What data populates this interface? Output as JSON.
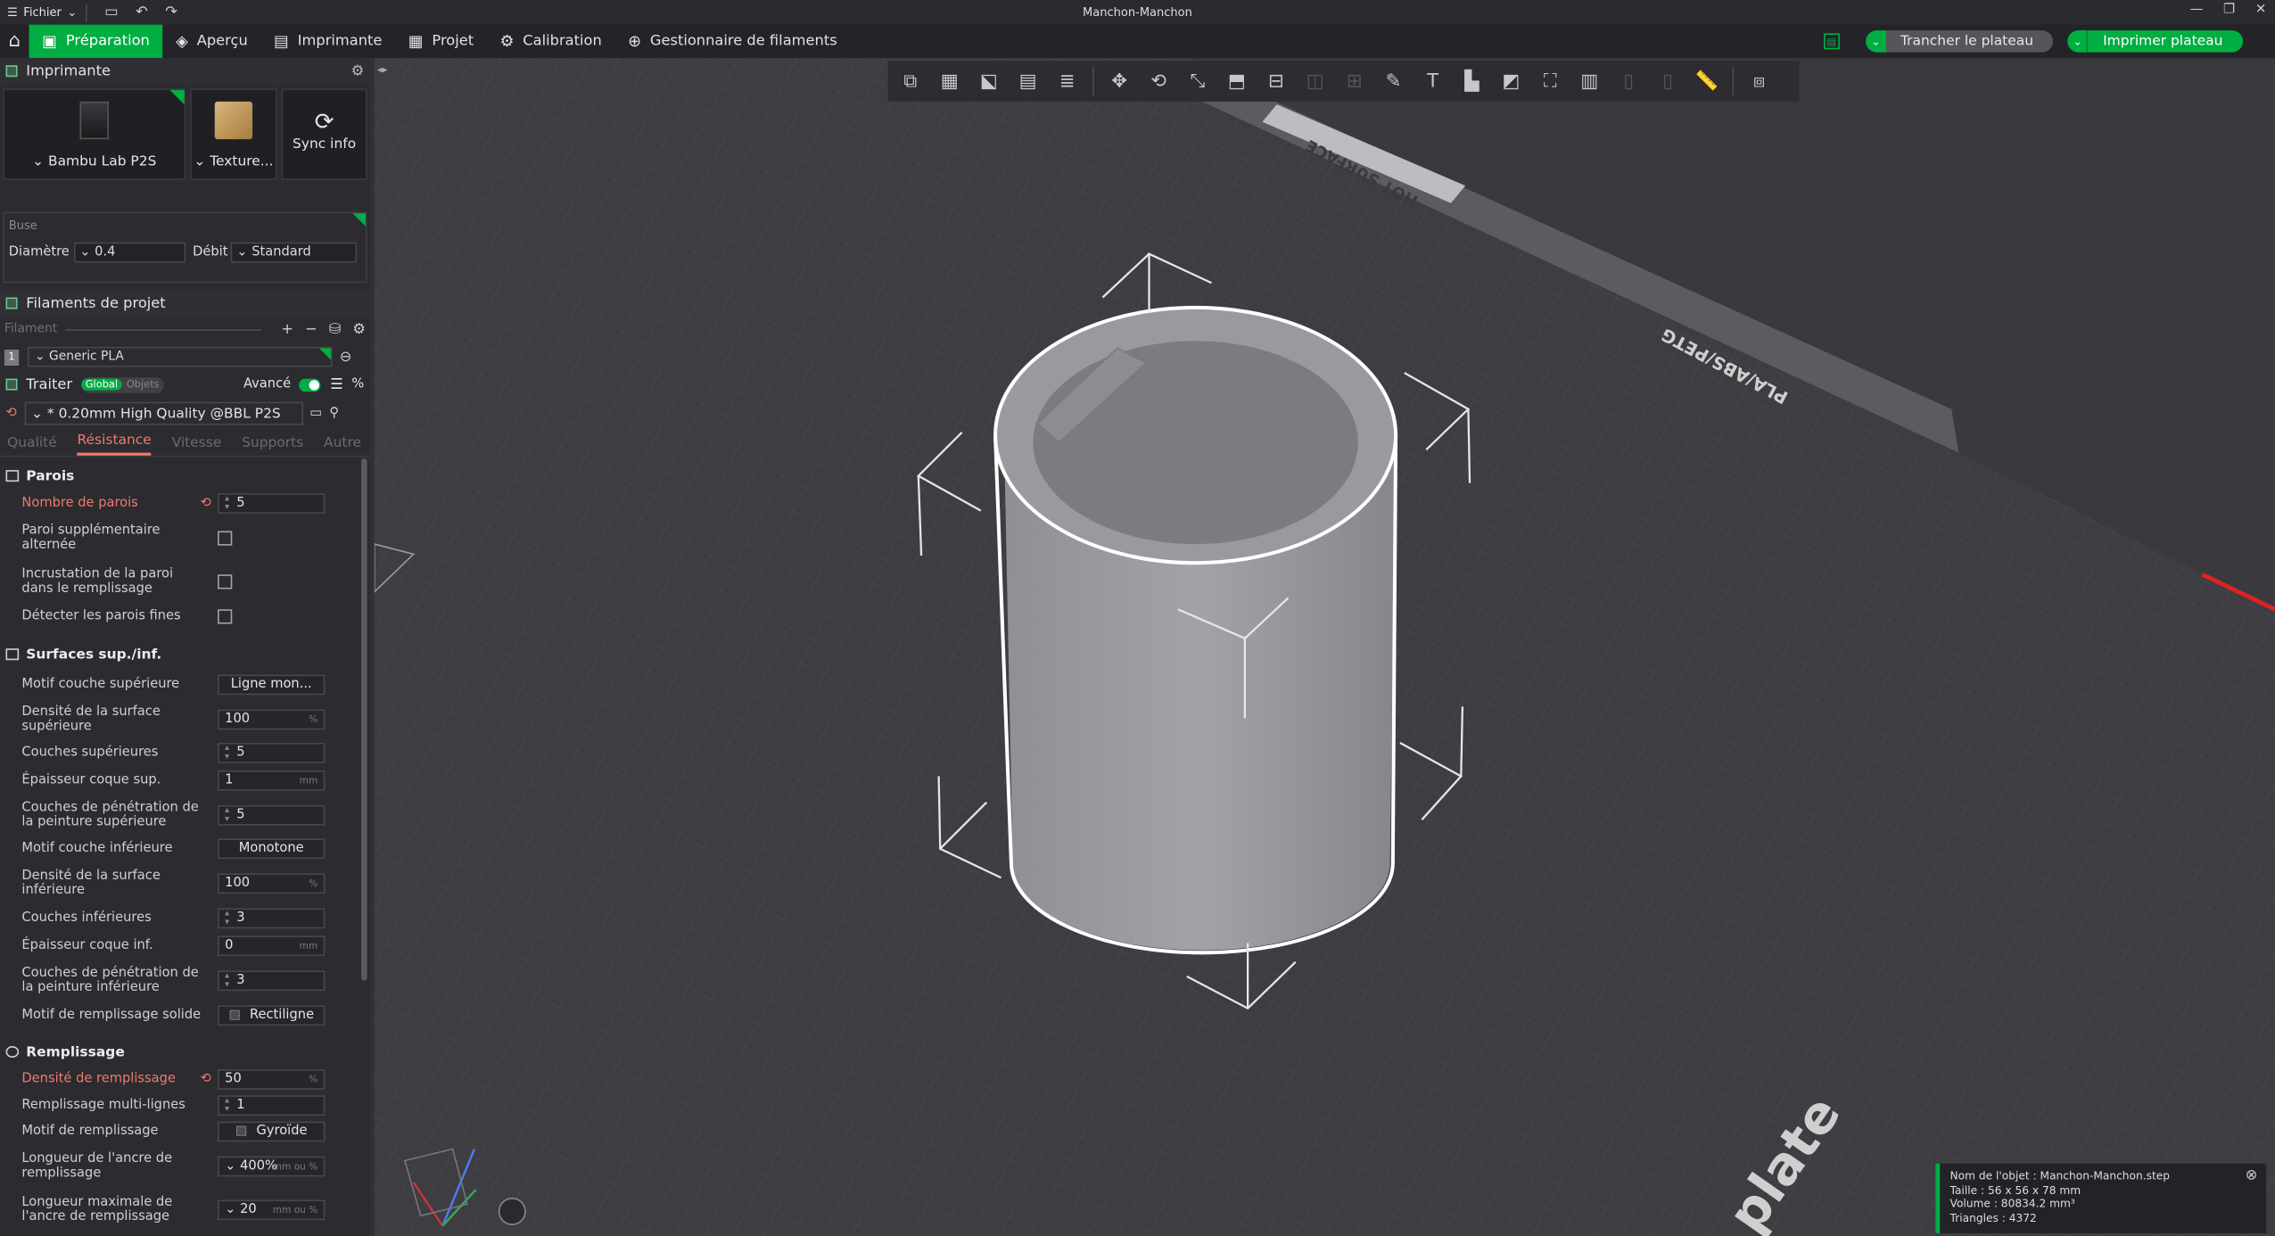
{
  "menu": {
    "file_label": "Fichier",
    "window_title": "Manchon-Manchon"
  },
  "tabs": [
    {
      "label": "Préparation",
      "icon": "prepare-icon"
    },
    {
      "label": "Aperçu",
      "icon": "preview-icon"
    },
    {
      "label": "Imprimante",
      "icon": "device-icon"
    },
    {
      "label": "Projet",
      "icon": "project-icon"
    },
    {
      "label": "Calibration",
      "icon": "calibration-icon"
    },
    {
      "label": "Gestionnaire de filaments",
      "icon": "filament-manager-icon"
    }
  ],
  "actions": {
    "slice": "Trancher le plateau",
    "print": "Imprimer plateau"
  },
  "printer": {
    "section_title": "Imprimante",
    "printer_name": "Bambu Lab P2S",
    "plate_label": "Texture...",
    "sync_label": "Sync info"
  },
  "nozzle": {
    "title": "Buse",
    "diameter_label": "Diamètre",
    "diameter_value": "0.4",
    "flow_label": "Débit",
    "flow_value": "Standard"
  },
  "filaments": {
    "title": "Filaments de projet",
    "filter_label": "Filament",
    "items": [
      {
        "num": "1",
        "name": "Generic PLA"
      }
    ]
  },
  "process": {
    "title": "Traiter",
    "global": "Global",
    "objects": "Objets",
    "advanced": "Avancé",
    "preset": "* 0.20mm High Quality @BBL P2S"
  },
  "ptabs": [
    "Qualité",
    "Résistance",
    "Vitesse",
    "Supports",
    "Autre"
  ],
  "groups": {
    "walls": {
      "title": "Parois",
      "options": [
        {
          "label": "Nombre de parois",
          "value": "5"
        },
        {
          "label": "Paroi supplémentaire alternée"
        },
        {
          "label": "Incrustation de la paroi dans le remplissage"
        },
        {
          "label": "Détecter les parois fines"
        }
      ]
    },
    "surfaces": {
      "title": "Surfaces sup./inf.",
      "options": [
        {
          "label": "Motif couche supérieure",
          "value": "Ligne mon..."
        },
        {
          "label": "Densité de la surface supérieure",
          "value": "100",
          "unit": "%"
        },
        {
          "label": "Couches supérieures",
          "value": "5"
        },
        {
          "label": "Épaisseur coque sup.",
          "value": "1",
          "unit": "mm"
        },
        {
          "label": "Couches de pénétration de la peinture supérieure",
          "value": "5"
        },
        {
          "label": "Motif couche inférieure",
          "value": "Monotone"
        },
        {
          "label": "Densité de la surface inférieure",
          "value": "100",
          "unit": "%"
        },
        {
          "label": "Couches inférieures",
          "value": "3"
        },
        {
          "label": "Épaisseur coque inf.",
          "value": "0",
          "unit": "mm"
        },
        {
          "label": "Couches de pénétration de la peinture inférieure",
          "value": "3"
        },
        {
          "label": "Motif de remplissage solide",
          "value": "Rectiligne"
        }
      ]
    },
    "infill": {
      "title": "Remplissage",
      "options": [
        {
          "label": "Densité de remplissage",
          "value": "50",
          "unit": "%"
        },
        {
          "label": "Remplissage multi-lignes",
          "value": "1"
        },
        {
          "label": "Motif de remplissage",
          "value": "Gyroïde"
        },
        {
          "label": "Longueur de l'ancre de remplissage",
          "value": "400%",
          "unit": "mm ou %"
        },
        {
          "label": "Longueur maximale de l'ancre de remplissage",
          "value": "20",
          "unit": "mm ou %"
        }
      ]
    }
  },
  "plate": {
    "hot_surface": "HOT SURFACE",
    "material": "PLA/ABS/PETG",
    "plate_text": "plate"
  },
  "object_info": {
    "name": "Nom de l'objet : Manchon-Manchon.step",
    "size": "Taille : 56 x 56 x 78 mm",
    "volume": "Volume : 80834.2 mm³",
    "triangles": "Triangles : 4372"
  },
  "colors": {
    "accent": "#00ae42",
    "modified": "#f0796a",
    "bed": "#3f3f44"
  }
}
